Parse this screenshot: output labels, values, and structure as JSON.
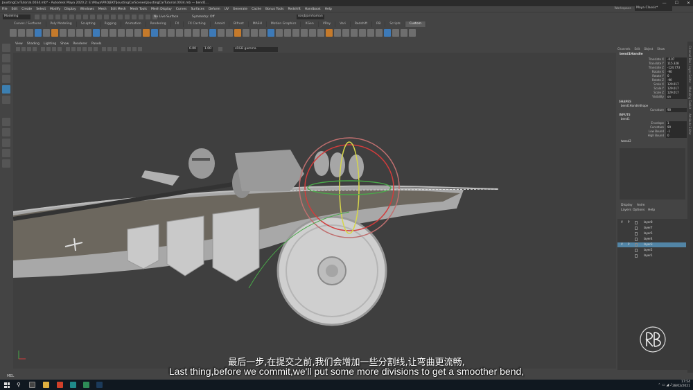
{
  "window": {
    "title": "JoustingCarTutorial.0034.mb* - Autodesk Maya 2020.2: E:\\Maya\\PROJEKT\\JoustingCarScenes\\JoustingCarTutorial.0034.mb — bend1...",
    "controls": [
      "—",
      "☐",
      "✕"
    ]
  },
  "menubar": {
    "items": [
      "File",
      "Edit",
      "Create",
      "Select",
      "Modify",
      "Display",
      "Windows",
      "Mesh",
      "Edit Mesh",
      "Mesh Tools",
      "Mesh Display",
      "Curves",
      "Surfaces",
      "Deform",
      "UV",
      "Generate",
      "Cache",
      "Bonus Tools",
      "Redshift",
      "Handbook",
      "Help"
    ],
    "workspace_label": "Workspace :",
    "workspace_value": "Maya Classic*"
  },
  "statusline": {
    "mode": "Modeling",
    "live_surface": "No Live Surface",
    "symmetry": "Symmetry: Off",
    "user": "ronjbjarnhaman"
  },
  "shelf": {
    "tabs": [
      "Curves / Surfaces",
      "Poly Modeling",
      "Sculpting",
      "Rigging",
      "Animation",
      "Rendering",
      "FX",
      "FX Caching",
      "Arnold",
      "Bifrost",
      "MASH",
      "Motion Graphics",
      "XGen",
      "VRay",
      "Vari",
      "Redshift",
      "RB",
      "Scripts",
      "Custom"
    ],
    "active_tab": "Custom"
  },
  "panel": {
    "menu": [
      "View",
      "Shading",
      "Lighting",
      "Show",
      "Renderer",
      "Panels"
    ],
    "near_clip": "0.00",
    "far_clip": "1.00",
    "color_space": "sRGB gamma"
  },
  "channel_box": {
    "header": [
      "Channels",
      "Edit",
      "Object",
      "Show"
    ],
    "object": "bend1Handle",
    "attributes": [
      {
        "name": "Translate X",
        "value": "-0.07"
      },
      {
        "name": "Translate Y",
        "value": "115.328"
      },
      {
        "name": "Translate Z",
        "value": "-124.773"
      },
      {
        "name": "Rotate X",
        "value": "-90"
      },
      {
        "name": "Rotate Y",
        "value": "0"
      },
      {
        "name": "Rotate Z",
        "value": "-90"
      },
      {
        "name": "Scale X",
        "value": "129.017"
      },
      {
        "name": "Scale Y",
        "value": "129.017"
      },
      {
        "name": "Scale Z",
        "value": "129.017"
      },
      {
        "name": "Visibility",
        "value": "on"
      }
    ],
    "shapes_label": "SHAPES",
    "shape_name": "bend1HandleShape",
    "shape_attrs": [
      {
        "name": "Curvature",
        "value": "90"
      }
    ],
    "inputs_label": "INPUTS",
    "input_name": "bend1",
    "input_attrs": [
      {
        "name": "Envelope",
        "value": "1"
      },
      {
        "name": "Curvature",
        "value": "90"
      },
      {
        "name": "Low Bound",
        "value": "-1"
      },
      {
        "name": "High Bound",
        "value": "0"
      }
    ],
    "extra_input": "tweak2"
  },
  "side_tabs": [
    "Channel Box / Layer Editor",
    "Modeling Toolkit",
    "Attribute Editor"
  ],
  "layers": {
    "tabs": [
      "Display",
      "Anim"
    ],
    "menu": [
      "Layers",
      "Options",
      "Help"
    ],
    "rows": [
      {
        "v": "V",
        "p": "P",
        "name": "layer8",
        "selected": false
      },
      {
        "v": "",
        "p": "",
        "name": "layer7",
        "selected": false
      },
      {
        "v": "",
        "p": "",
        "name": "layer5",
        "selected": false
      },
      {
        "v": "",
        "p": "",
        "name": "layer4",
        "selected": false
      },
      {
        "v": "V",
        "p": "P",
        "name": "layer3",
        "selected": true
      },
      {
        "v": "",
        "p": "",
        "name": "layer2",
        "selected": false
      },
      {
        "v": "",
        "p": "",
        "name": "layer1",
        "selected": false
      }
    ]
  },
  "helpline": {
    "mel": "MEL"
  },
  "subtitles": {
    "cn": "最后一步,在提交之前,我们会增加一些分割线,让弯曲更流畅,",
    "en": "Last thing,before we commit,we'll put some more divisions to get a smoother bend,"
  },
  "taskbar": {
    "time": "17:54",
    "date": "28/02/2021"
  },
  "colors": {
    "accent": "#5285a6",
    "viewport_bg": "#3f3f3f",
    "shelf_blue": "#3d7ab8",
    "shelf_orange": "#c57a2b"
  }
}
